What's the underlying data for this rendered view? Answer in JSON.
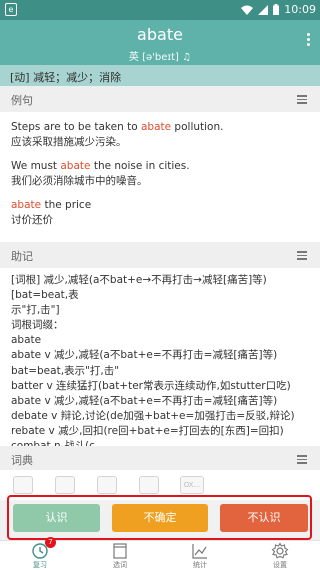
{
  "status_bar": {
    "app_icon_text": "e",
    "time": "10:09"
  },
  "header": {
    "word": "abate",
    "phonetic": "英 [ə'beɪt] ♫"
  },
  "definition": "[动] 减轻；减少；消除",
  "examples": {
    "title": "例句",
    "items": [
      {
        "en": [
          "Steps are to be taken to ",
          "abate",
          " pollution."
        ],
        "zh": "应该采取措施减少污染。"
      },
      {
        "en": [
          "We must ",
          "abate",
          " the noise in cities."
        ],
        "zh": "我们必须消除城市中的噪音。"
      },
      {
        "en": [
          "",
          "abate",
          " the price"
        ],
        "zh": "讨价还价"
      }
    ]
  },
  "memory": {
    "title": "助记",
    "lines": [
      "[词根] 减少,减轻(a不bat+e→不再打击→减轻[痛苦]等)[bat=beat,表",
      "示\"打,击\"]",
      "词根词缀：",
      "abate",
      "abate v 减少,减轻(a不bat+e=不再打击=减轻[痛苦]等)",
      "bat=beat,表示\"打,击\"",
      "batter v 连续猛打(bat+ter常表示连续动作,如stutter口吃)",
      "abate v 减少,减轻(a不bat+e=不再打击=减轻[痛苦]等)",
      "debate v 辩论,讨论(de加强+bat+e=加强打击=反驳,辩论)",
      "rebate v 减少,回扣(re回+bat+e=打回去的[东西]=回扣)",
      "combat n 战斗(c"
    ]
  },
  "dictionary": {
    "title": "词典",
    "icons": [
      "dict-book-icon",
      "dict-person-icon",
      "dict-chat-icon",
      "bing-icon",
      "oxford-icon"
    ],
    "oxford_label": "OX..."
  },
  "actions": {
    "know": "认识",
    "unsure": "不确定",
    "unknown": "不认识"
  },
  "bottom_nav": {
    "items": [
      {
        "label": "复习",
        "icon": "review-clock-icon",
        "active": true,
        "badge": "7"
      },
      {
        "label": "选词",
        "icon": "word-book-icon",
        "active": false
      },
      {
        "label": "统计",
        "icon": "stats-chart-icon",
        "active": false
      },
      {
        "label": "设置",
        "icon": "gear-icon",
        "active": false
      }
    ]
  },
  "colors": {
    "status_bar": "#3e8f86",
    "header": "#5fb2aa",
    "definition_bar": "#a7d3d0",
    "highlight": "#e04b2c",
    "know_button": "#8fc9a9",
    "unsure_button": "#f0a020",
    "unknown_button": "#e2643e",
    "frame": "#e2131a"
  }
}
